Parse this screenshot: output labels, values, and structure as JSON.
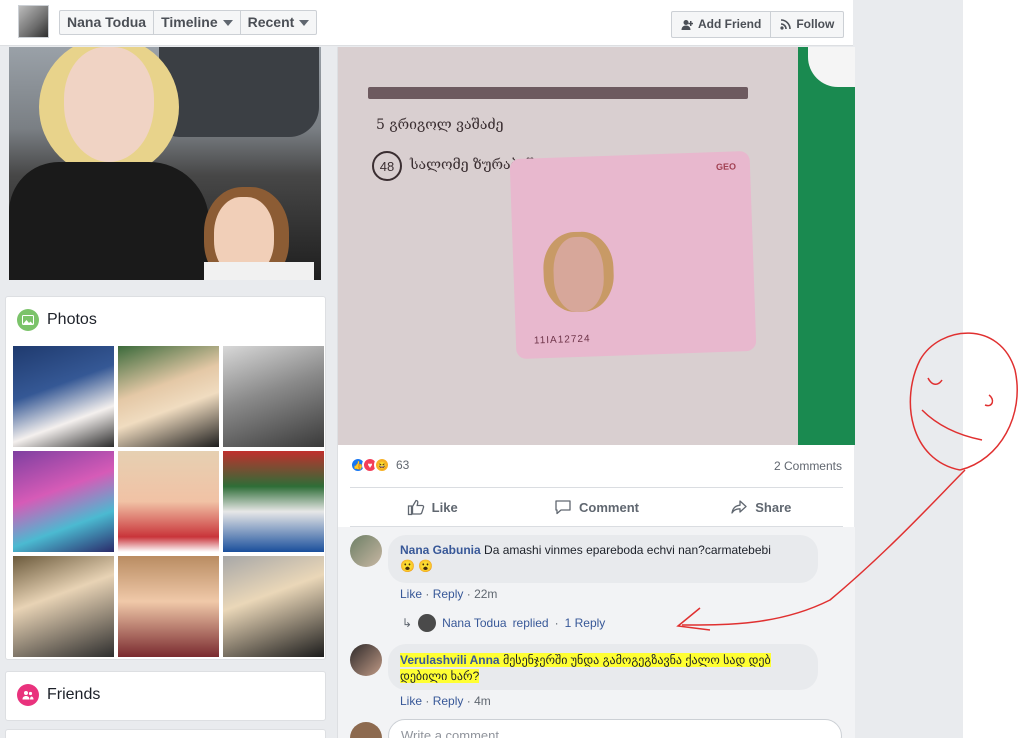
{
  "header": {
    "profile_name": "Nana Todua",
    "timeline_label": "Timeline",
    "recent_label": "Recent",
    "add_friend_label": "Add Friend",
    "follow_label": "Follow"
  },
  "sidebar": {
    "photos_title": "Photos",
    "friends_title": "Friends"
  },
  "post": {
    "reaction_count": "63",
    "comments_count": "2 Comments",
    "like_label": "Like",
    "comment_label": "Comment",
    "share_label": "Share",
    "document": {
      "line5": "5  გრიგოლ ვაშაძე",
      "line48": "სალომე ზურაბიშვილი",
      "line48_num": "48",
      "geo": "GEO",
      "card_number": "11IA12724"
    }
  },
  "comments": [
    {
      "author": "Nana Gabunia",
      "text": "Da amashi vinmes epareboda echvi nan?carmatebebi",
      "emoji": "😮 😮",
      "like": "Like",
      "reply": "Reply",
      "time": "22m"
    },
    {
      "author": "Verulashvili Anna",
      "text": "მესენჯერში უნდა გამოგეგზავნა ქალო სად დებ დებილი ხარ?",
      "like": "Like",
      "reply": "Reply",
      "time": "4m"
    }
  ],
  "replies": {
    "author": "Nana Todua",
    "replied": "replied",
    "count": "1 Reply"
  },
  "composer": {
    "placeholder": "Write a comment..."
  },
  "colors": {
    "link": "#385898",
    "highlight": "#ffff33",
    "annotation": "#e03030"
  }
}
